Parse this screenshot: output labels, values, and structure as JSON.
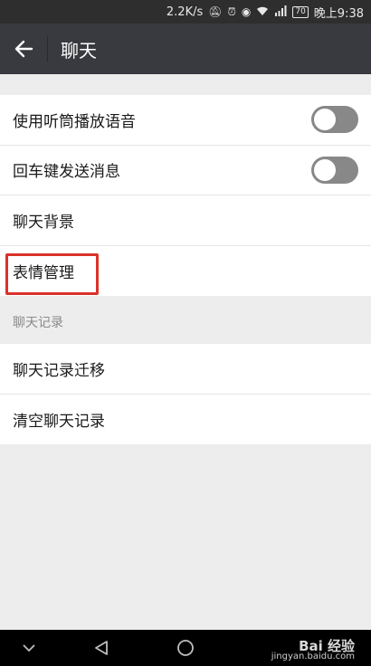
{
  "status_bar": {
    "speed": "2.2K/s",
    "battery": "70",
    "time": "晚上9:38"
  },
  "app_bar": {
    "title": "聊天"
  },
  "settings_group1": [
    {
      "label": "使用听筒播放语音",
      "toggle": false
    },
    {
      "label": "回车键发送消息",
      "toggle": false
    },
    {
      "label": "聊天背景"
    },
    {
      "label": "表情管理"
    }
  ],
  "section_header": "聊天记录",
  "settings_group2": [
    {
      "label": "聊天记录迁移"
    },
    {
      "label": "清空聊天记录"
    }
  ],
  "watermark": {
    "brand": "Bai 经验",
    "url": "jingyan.baidu.com"
  },
  "colors": {
    "app_bar": "#393a3f",
    "highlight": "#d9322b",
    "toggle_off": "#888888"
  }
}
